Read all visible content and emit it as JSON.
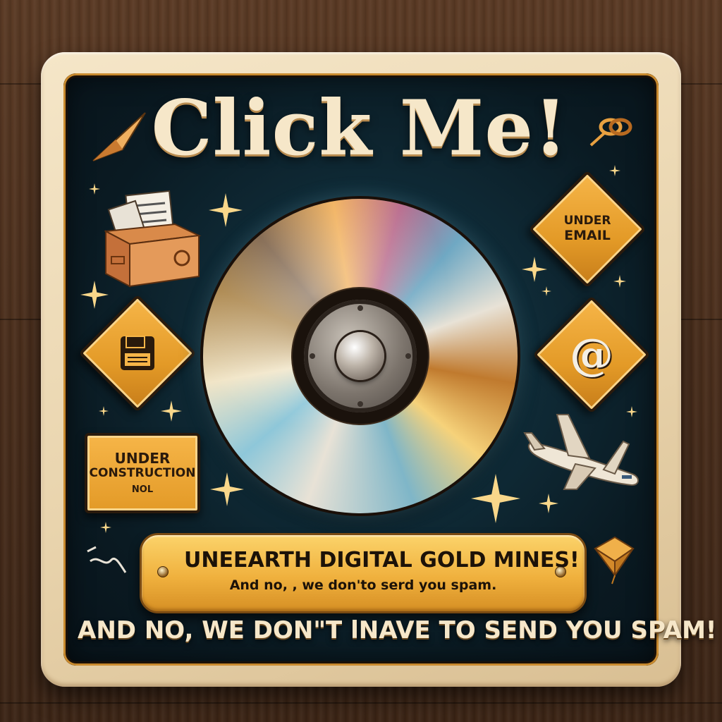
{
  "poster": {
    "title": "Click Me!",
    "signs": {
      "under_email_line1": "UNDER",
      "under_email_line2": "EMAIL",
      "at_symbol": "@",
      "construction_line1": "UNDER",
      "construction_line2": "CONSTRUCTION",
      "construction_line3": "NOL"
    },
    "plaque": {
      "line1": "UNEEARTH DIGITAL GOLD MINES!",
      "line2": "And no, , we don'to serd you spam."
    },
    "footer": "AND NO, WE DON\"T lNAVE TO SEND YOU SPAM!"
  },
  "colors": {
    "panel_background": "#0f2a36",
    "frame": "#e9d4ad",
    "sign_orange": "#e39a27",
    "title_text": "#f6e7c9",
    "plaque_gold": "#f0b13e",
    "wood": "#4a2e1c"
  },
  "icons": [
    "paper-plane-icon",
    "link-chain-icon",
    "inbox-documents-icon",
    "floppy-disk-icon",
    "at-sign-icon",
    "airplane-icon",
    "envelope-kite-icon",
    "sparkle-icon",
    "compact-disc-icon"
  ]
}
